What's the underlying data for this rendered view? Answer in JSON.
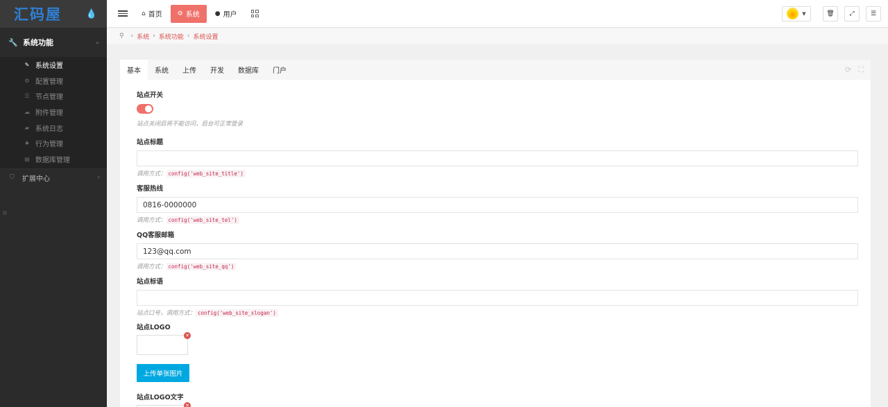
{
  "sidebar": {
    "logo": "汇码屋",
    "toggle_icon": "drop-icon",
    "group_main": {
      "label": "系统功能",
      "icon": "wrench-icon"
    },
    "items": [
      {
        "label": "系统设置",
        "active": true
      },
      {
        "label": "配置管理"
      },
      {
        "label": "节点管理"
      },
      {
        "label": "附件管理"
      },
      {
        "label": "系统日志"
      },
      {
        "label": "行为管理"
      },
      {
        "label": "数据库管理"
      }
    ],
    "group_ext": {
      "label": "扩展中心"
    }
  },
  "topbar": {
    "nav": [
      {
        "label": "首页",
        "icon": "home-icon"
      },
      {
        "label": "系统",
        "icon": "gear-icon",
        "active": true
      },
      {
        "label": "用户",
        "icon": "user-icon"
      }
    ]
  },
  "breadcrumb": [
    "系统",
    "系统功能",
    "系统设置"
  ],
  "tabs": [
    "基本",
    "系统",
    "上传",
    "开发",
    "数据库",
    "门户"
  ],
  "form": {
    "site_switch": {
      "label": "站点开关",
      "help": "站点关闭后将不能访问，后台可正常登录",
      "enabled": true
    },
    "site_title": {
      "label": "站点标题",
      "value": "",
      "help_prefix": "调用方式：",
      "code": "config('web_site_title')"
    },
    "hotline": {
      "label": "客服热线",
      "value": "0816-0000000",
      "help_prefix": "调用方式：",
      "code": "config('web_site_tel')"
    },
    "qq_email": {
      "label": "QQ客服邮箱",
      "value": "123@qq.com",
      "help_prefix": "调用方式：",
      "code": "config('web_site_qq')"
    },
    "slogan": {
      "label": "站点标语",
      "value": "",
      "help_prefix": "站点口号，调用方式：",
      "code": "config('web_site_slogan')"
    },
    "logo": {
      "label": "站点LOGO",
      "upload_label": "上传单张图片"
    },
    "logo_text": {
      "label": "站点LOGO文字"
    }
  },
  "colors": {
    "accent": "#f0706a",
    "upload": "#00a8e1",
    "sidebar": "#2b2b2b"
  }
}
